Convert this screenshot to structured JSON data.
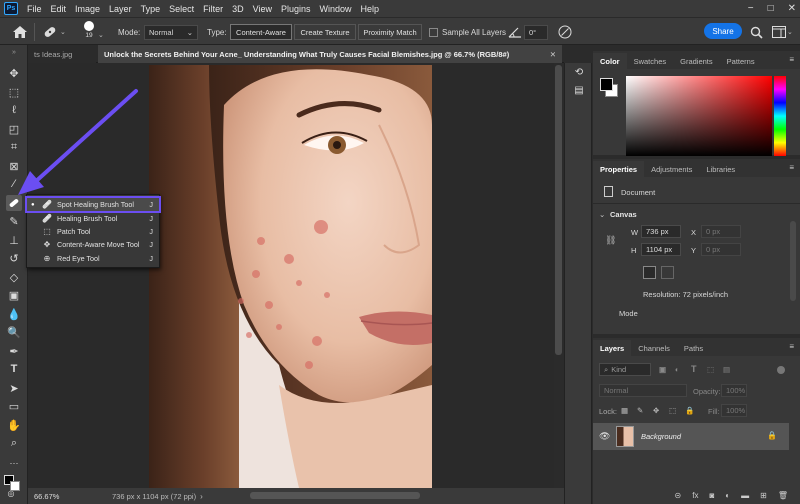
{
  "app": {
    "logo": "Ps"
  },
  "menu": [
    "File",
    "Edit",
    "Image",
    "Layer",
    "Type",
    "Select",
    "Filter",
    "3D",
    "View",
    "Plugins",
    "Window",
    "Help"
  ],
  "window_controls": [
    "−",
    "□",
    "✕"
  ],
  "options": {
    "brush_size": "19",
    "mode_label": "Mode:",
    "mode_value": "Normal",
    "type_label": "Type:",
    "type_buttons": [
      "Content-Aware",
      "Create Texture",
      "Proximity Match"
    ],
    "sample_all_layers": "Sample All Layers",
    "angle_value": "0°",
    "share": "Share"
  },
  "tabs": {
    "inactive": "ts Ideas.jpg",
    "active": "Unlock the Secrets Behind Your Acne_ Understanding What Truly Causes Facial Blemishes.jpg @ 66.7% (RGB/8#)"
  },
  "flyout": {
    "items": [
      {
        "label": "Spot Healing Brush Tool",
        "key": "J",
        "icon": "spot-healing-brush-icon",
        "glyph": "🩹"
      },
      {
        "label": "Healing Brush Tool",
        "key": "J",
        "icon": "healing-brush-icon",
        "glyph": "🩹"
      },
      {
        "label": "Patch Tool",
        "key": "J",
        "icon": "patch-icon",
        "glyph": "⬚"
      },
      {
        "label": "Content-Aware Move Tool",
        "key": "J",
        "icon": "content-aware-move-icon",
        "glyph": "✥"
      },
      {
        "label": "Red Eye Tool",
        "key": "J",
        "icon": "red-eye-icon",
        "glyph": "⊕"
      }
    ]
  },
  "status": {
    "zoom": "66.67%",
    "doc": "736 px x 1104 px (72 ppi)"
  },
  "color_panel": {
    "tabs": [
      "Color",
      "Swatches",
      "Gradients",
      "Patterns"
    ]
  },
  "properties": {
    "tabs": [
      "Properties",
      "Adjustments",
      "Libraries"
    ],
    "document_label": "Document",
    "canvas_label": "Canvas",
    "w_label": "W",
    "w_value": "736 px",
    "h_label": "H",
    "h_value": "1104 px",
    "x_label": "X",
    "x_value": "0 px",
    "y_label": "Y",
    "y_value": "0 px",
    "resolution": "Resolution: 72 pixels/inch",
    "mode_label": "Mode"
  },
  "layers": {
    "tabs": [
      "Layers",
      "Channels",
      "Paths"
    ],
    "filter": "Kind",
    "blend": "Normal",
    "opacity_label": "Opacity:",
    "opacity_value": "100%",
    "lock_label": "Lock:",
    "fill_label": "Fill:",
    "fill_value": "100%",
    "layer_name": "Background"
  },
  "colors": {
    "accent": "#1473e6",
    "highlight": "#6b4ef2",
    "arrow": "#6b4ef2"
  }
}
